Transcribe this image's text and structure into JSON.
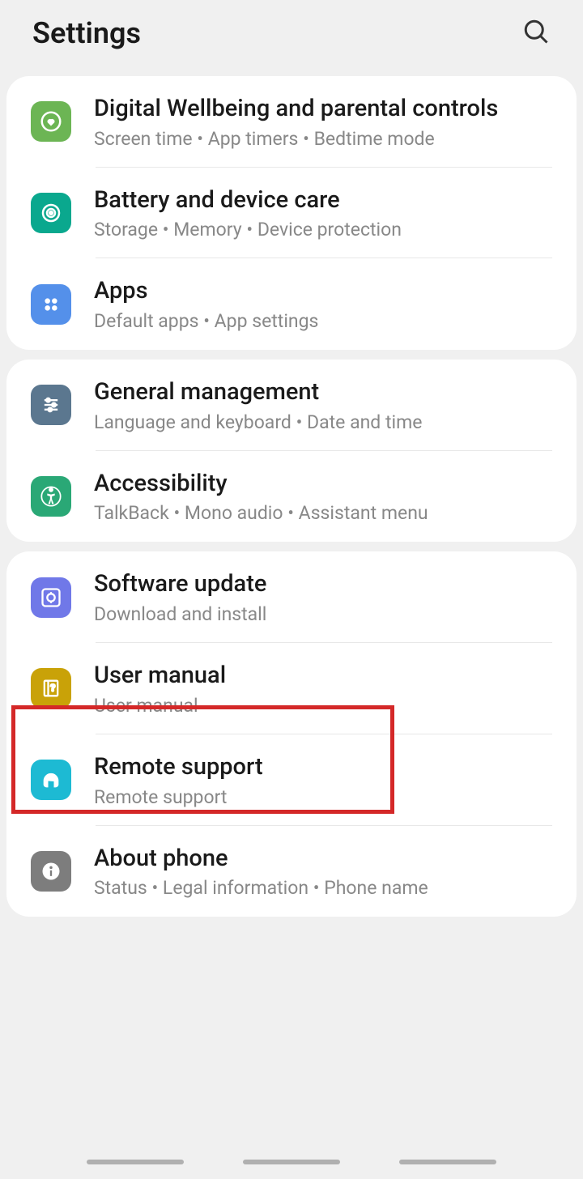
{
  "header": {
    "title": "Settings"
  },
  "sections": [
    {
      "items": [
        {
          "id": "digital-wellbeing",
          "icon": "heart-circle-icon",
          "bg": "bg-green1",
          "title": "Digital Wellbeing and parental controls",
          "subtitle": "Screen time  •  App timers  •  Bedtime mode"
        },
        {
          "id": "battery-device-care",
          "icon": "spiral-icon",
          "bg": "bg-teal",
          "title": "Battery and device care",
          "subtitle": "Storage  •  Memory  •  Device protection"
        },
        {
          "id": "apps",
          "icon": "dots-icon",
          "bg": "bg-blue",
          "title": "Apps",
          "subtitle": "Default apps  •  App settings"
        }
      ]
    },
    {
      "items": [
        {
          "id": "general-management",
          "icon": "sliders-icon",
          "bg": "bg-bluegray",
          "title": "General management",
          "subtitle": "Language and keyboard  •  Date and time"
        },
        {
          "id": "accessibility",
          "icon": "person-icon",
          "bg": "bg-green2",
          "title": "Accessibility",
          "subtitle": "TalkBack  •  Mono audio  •  Assistant menu"
        }
      ]
    },
    {
      "items": [
        {
          "id": "software-update",
          "icon": "refresh-icon",
          "bg": "bg-purple",
          "title": "Software update",
          "subtitle": "Download and install"
        },
        {
          "id": "user-manual",
          "icon": "book-icon",
          "bg": "bg-yellow",
          "title": "User manual",
          "subtitle": "User manual"
        },
        {
          "id": "remote-support",
          "icon": "headset-icon",
          "bg": "bg-cyan",
          "title": "Remote support",
          "subtitle": "Remote support"
        },
        {
          "id": "about-phone",
          "icon": "info-icon",
          "bg": "bg-gray",
          "title": "About phone",
          "subtitle": "Status  •  Legal information  •  Phone name"
        }
      ]
    }
  ]
}
